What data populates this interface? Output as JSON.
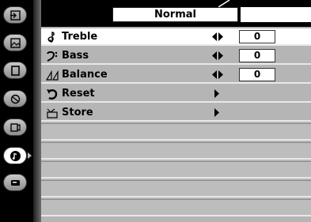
{
  "mode": {
    "label": "Normal"
  },
  "tabs": [
    {
      "icon": "input-icon"
    },
    {
      "icon": "image-icon"
    },
    {
      "icon": "screen-icon"
    },
    {
      "icon": "color-icon"
    },
    {
      "icon": "setting-icon"
    },
    {
      "icon": "sound-icon",
      "active": true
    },
    {
      "icon": "projector-icon"
    }
  ],
  "menu": {
    "treble": {
      "label": "Treble",
      "value": "0",
      "icon": "treble-clef-icon"
    },
    "bass": {
      "label": "Bass",
      "value": "0",
      "icon": "bass-clef-icon"
    },
    "balance": {
      "label": "Balance",
      "value": "0",
      "icon": "balance-icon"
    },
    "reset": {
      "label": "Reset",
      "icon": "reset-icon"
    },
    "store": {
      "label": "Store",
      "icon": "store-icon"
    }
  }
}
